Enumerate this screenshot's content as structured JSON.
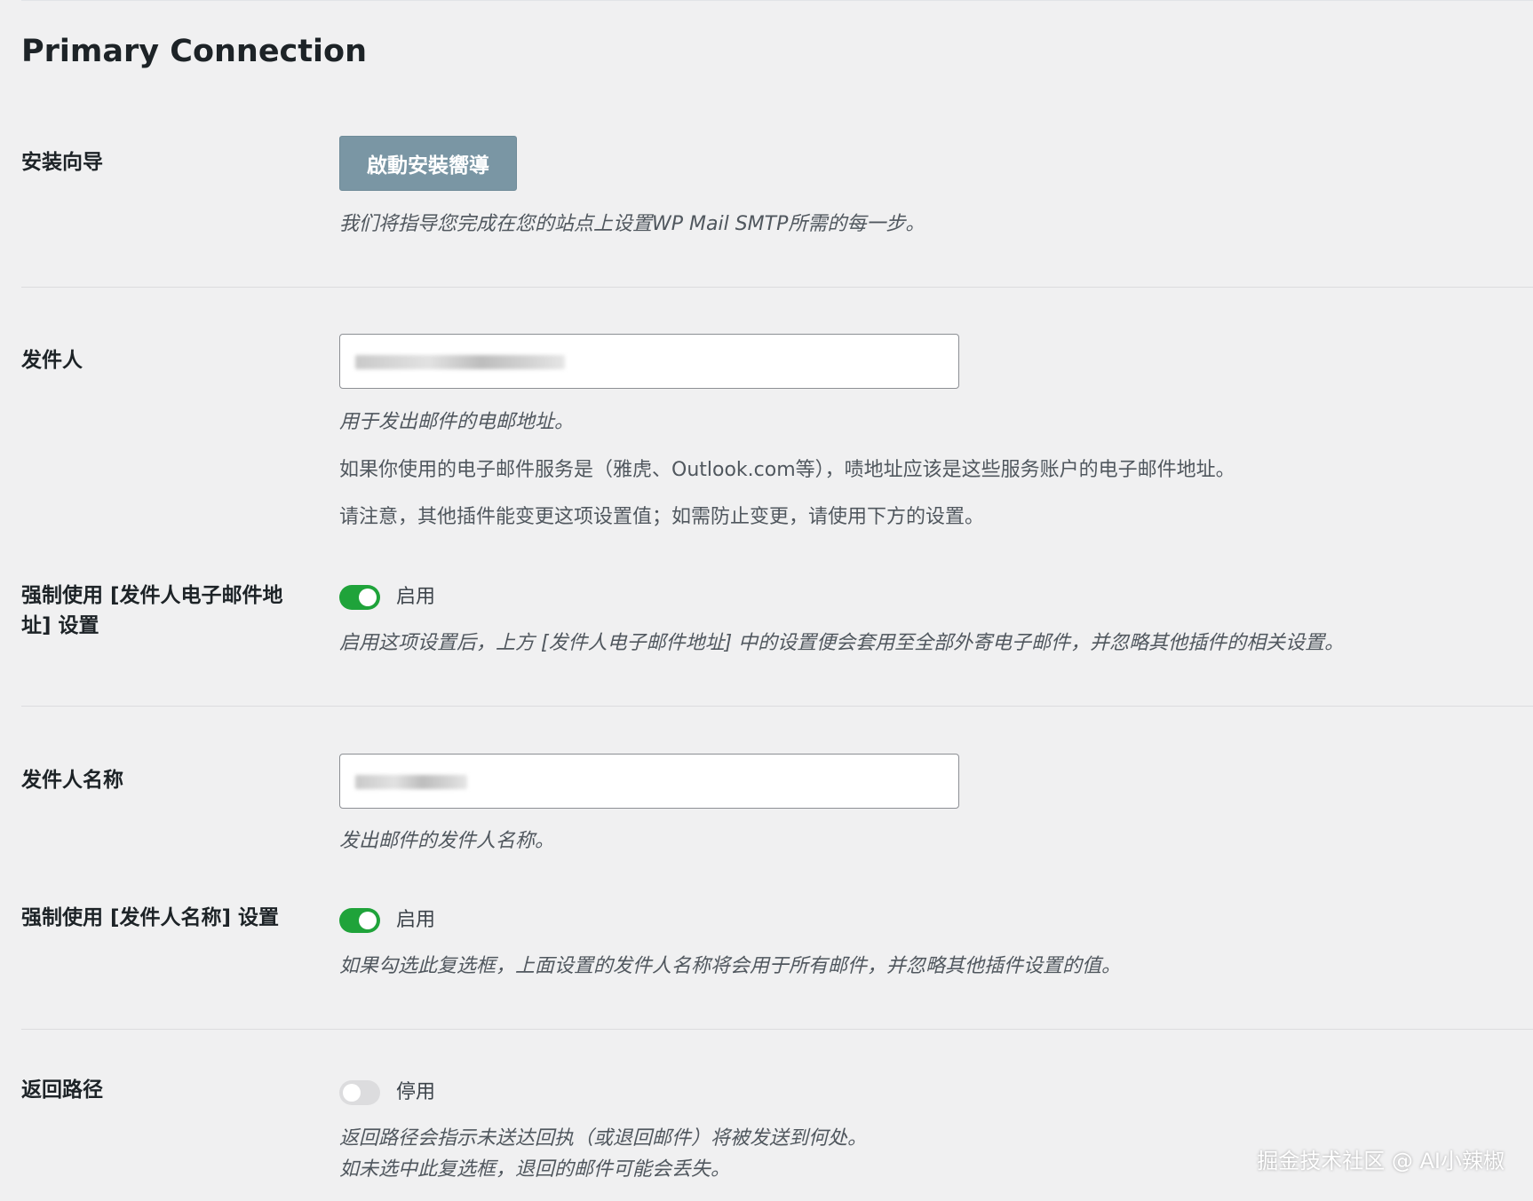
{
  "page": {
    "title": "Primary Connection"
  },
  "setup_wizard": {
    "label": "安装向导",
    "button_label": "啟動安裝嚮導",
    "description": "我们将指导您完成在您的站点上设置WP Mail SMTP所需的每一步。"
  },
  "from_email": {
    "label": "发件人",
    "value": "",
    "description": "用于发出邮件的电邮地址。",
    "note1": "如果你使用的电子邮件服务是（雅虎、Outlook.com等），啧地址应该是这些服务账户的电子邮件地址。",
    "note2": "请注意，其他插件能变更这项设置值；如需防止变更，请使用下方的设置。"
  },
  "force_from_email": {
    "label_line1": "强制使用 [发件人电子邮件地",
    "label_line2": "址] 设置",
    "enabled": true,
    "state_label": "启用",
    "description": "启用这项设置后，上方 [发件人电子邮件地址] 中的设置便会套用至全部外寄电子邮件，并忽略其他插件的相关设置。"
  },
  "from_name": {
    "label": "发件人名称",
    "value": "",
    "description": "发出邮件的发件人名称。"
  },
  "force_from_name": {
    "label": "强制使用 [发件人名称] 设置",
    "enabled": true,
    "state_label": "启用",
    "description": "如果勾选此复选框，上面设置的发件人名称将会用于所有邮件，并忽略其他插件设置的值。"
  },
  "return_path": {
    "label": "返回路径",
    "enabled": false,
    "state_label": "停用",
    "description1": "返回路径会指示未送达回执（或退回邮件）将被发送到何处。",
    "description2": "如未选中此复选框，退回的邮件可能会丢失。"
  },
  "watermark": {
    "text": "掘金技术社区 @ AI小辣椒"
  },
  "colors": {
    "toggle_on": "#1fa33a",
    "toggle_off": "#dcdcde",
    "wizard_button": "#7a96a4",
    "background": "#f0f0f1"
  }
}
